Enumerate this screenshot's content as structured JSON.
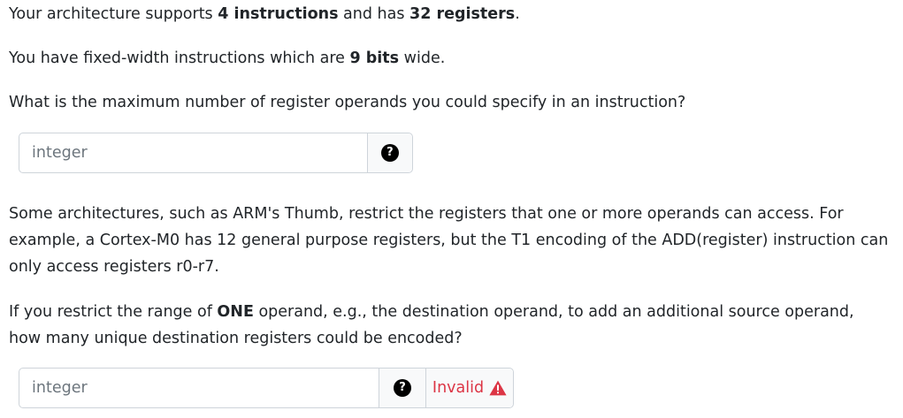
{
  "q1": {
    "line1": {
      "pre": "Your architecture supports ",
      "bold1": "4 instructions",
      "mid": " and has ",
      "bold2": "32 registers",
      "post": "."
    },
    "line2": {
      "pre": "You have fixed-width instructions which are ",
      "bold": "9 bits",
      "post": " wide."
    },
    "question": "What is the maximum number of register operands you could specify in an instruction?",
    "input": {
      "placeholder": "integer",
      "value": ""
    },
    "help_icon": "question-circle-icon",
    "help_glyph": "?"
  },
  "q2": {
    "paragraph": "Some architectures, such as ARM's Thumb, restrict the registers that one or more operands can access. For example, a Cortex-M0 has 12 general purpose registers, but the T1 encoding of the ADD(register) instruction can only access registers r0-r7.",
    "question": {
      "pre": "If you restrict the range of ",
      "bold": "ONE",
      "post": " operand, e.g., the destination operand, to add an additional source operand, how many unique destination registers could be encoded?"
    },
    "input": {
      "placeholder": "integer",
      "value": ""
    },
    "help_icon": "question-circle-icon",
    "help_glyph": "?",
    "status": {
      "label": "Invalid",
      "icon": "warning-triangle-icon",
      "color": "#dc3545"
    }
  }
}
